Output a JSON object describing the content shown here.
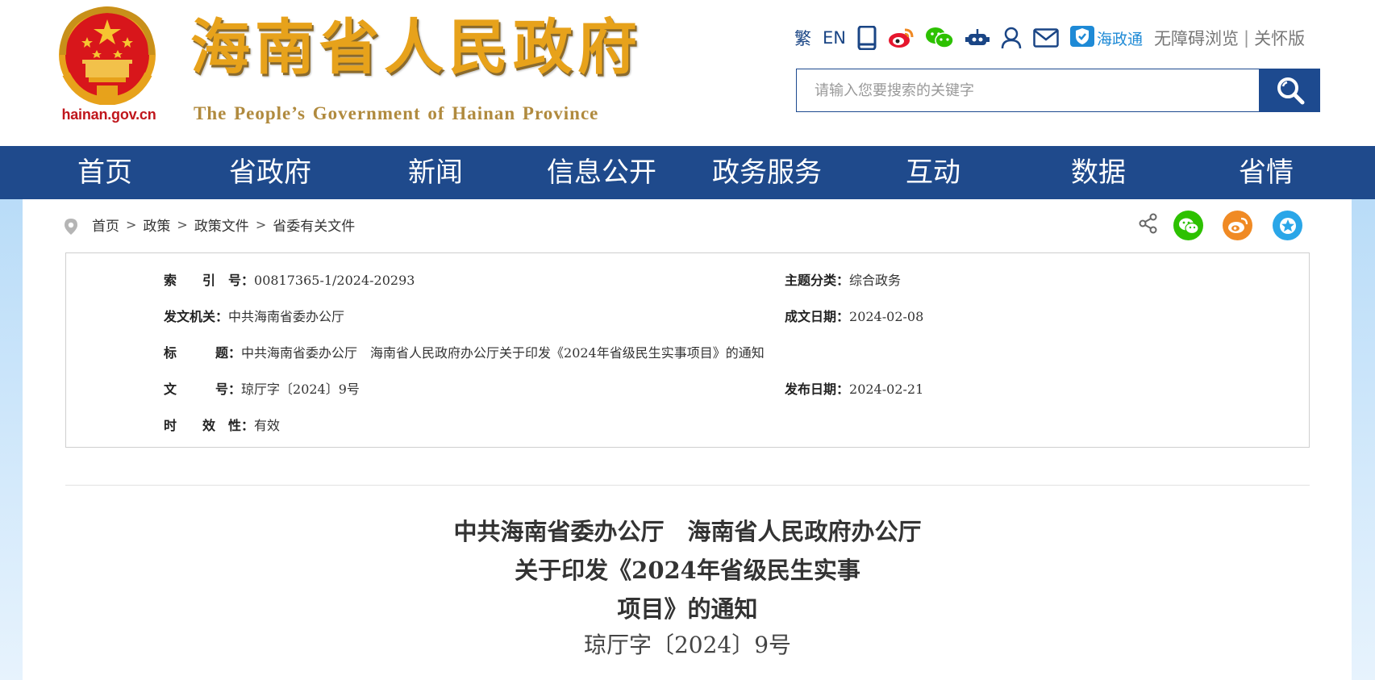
{
  "header": {
    "site_title": "海南省人民政府",
    "site_subtitle": "The People’s Government  of Hainan Province",
    "domain": "hainan.gov.cn",
    "toolbar": {
      "traditional": "繁",
      "english": "EN",
      "haizhengtong": "海政通",
      "accessible": "无障碍浏览",
      "separator": "|",
      "elderly": "关怀版"
    },
    "search": {
      "placeholder": "请输入您要搜索的关键字"
    }
  },
  "nav": {
    "items": [
      {
        "label": "首页"
      },
      {
        "label": "省政府"
      },
      {
        "label": "新闻"
      },
      {
        "label": "信息公开"
      },
      {
        "label": "政务服务"
      },
      {
        "label": "互动"
      },
      {
        "label": "数据"
      },
      {
        "label": "省情"
      }
    ]
  },
  "breadcrumb": {
    "items": [
      "首页",
      "政策",
      "政策文件",
      "省委有关文件"
    ],
    "separator": ">"
  },
  "meta": {
    "index_label": "索　　引　号：",
    "index_value": "00817365-1/2024-20293",
    "topic_label": "主题分类：",
    "topic_value": "综合政务",
    "issuer_label": "发文机关：",
    "issuer_value": "中共海南省委办公厅",
    "written_label": "成文日期：",
    "written_value": "2024-02-08",
    "title_label": "标　　　题：",
    "title_value": "中共海南省委办公厅　海南省人民政府办公厅关于印发《2024年省级民生实事项目》的通知",
    "docno_label": "文　　　号：",
    "docno_value": "琼厅字〔2024〕9号",
    "published_label": "发布日期：",
    "published_value": "2024-02-21",
    "validity_label": "时　　效　性：",
    "validity_value": "有效"
  },
  "document": {
    "title_line1": "中共海南省委办公厅　海南省人民政府办公厅",
    "title_line2": "关于印发《2024年省级民生实事",
    "title_line3": "项目》的通知",
    "number": "琼厅字〔2024〕9号"
  },
  "colors": {
    "nav_bg": "#1f4a8c",
    "title_gold": "#e7a21b",
    "emblem_red": "#d8161b",
    "wechat_green": "#2dc100",
    "weibo_orange": "#f08a24",
    "favorite_blue": "#2aa6e8"
  },
  "icons": [
    "tablet-icon",
    "weibo-icon",
    "wechat-icon",
    "robot-icon",
    "user-icon",
    "mail-icon",
    "haizhengtong-icon",
    "search-icon",
    "location-pin-icon",
    "share-icon",
    "wechat-share-icon",
    "weibo-share-icon",
    "favorite-star-icon"
  ]
}
